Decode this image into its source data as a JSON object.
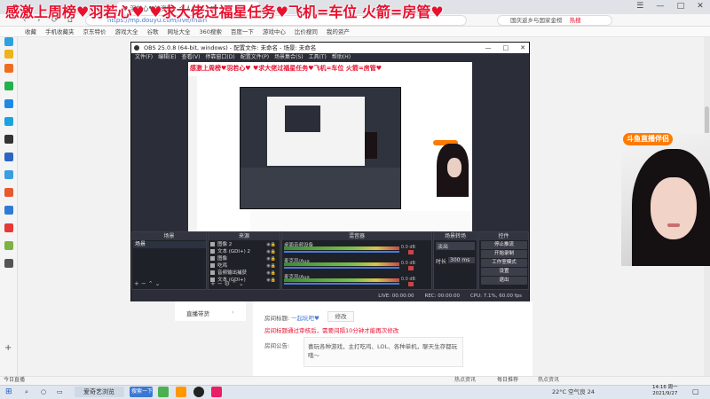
{
  "banner": {
    "text": "感激上周榜♥羽若心♥    ♥求大佬过福星任务♥飞机=车位 火箭=房管♥"
  },
  "browser": {
    "tab_title": "♥ 羽若心♥的资料 - 个人中心 - ♥",
    "url": "https://mp.douyu.com/live/main",
    "search_text": "国庆返乡与国家金榜",
    "search_hot": "热搜",
    "bookmarks": [
      "收藏",
      "手机收藏夹",
      "京东特价",
      "游戏大全",
      "谷歌",
      "网址大全",
      "360搜索",
      "百度一下",
      "游戏中心",
      "比价搜同",
      "我的资产"
    ]
  },
  "obs": {
    "title": "OBS 25.0.8 (64-bit, windows) - 配置文件: 未命名 - 场景: 未命名",
    "menu": [
      "文件(F)",
      "编辑(E)",
      "查看(V)",
      "停靠窗口(D)",
      "配置文件(P)",
      "场景集合(S)",
      "工具(T)",
      "帮助(H)"
    ],
    "preview_banner": "感激上周榜♥羽若心♥    ♥求大佬过福星任务♥飞机=车位 火箭=房管♥",
    "docks": {
      "scenes_title": "场景",
      "scene_name": "场景",
      "sources_title": "来源",
      "sources": [
        "图像 2",
        "文本 (GDI+) 2",
        "图像",
        "吃鸡",
        "音频输出捕获",
        "文本 (GDI+)"
      ],
      "mixer_title": "混音器",
      "mixer": [
        {
          "name": "桌面音频设备",
          "vol": "0.0 dB"
        },
        {
          "name": "麦克风/Aux",
          "vol": "0.0 dB"
        },
        {
          "name": "麦克风/Aux",
          "vol": "0.0 dB"
        }
      ],
      "transitions_title": "场景转场",
      "transition_type": "淡出",
      "duration_label": "时长",
      "duration_value": "300 ms",
      "controls_title": "控件",
      "controls": [
        "停止推流",
        "开始录制",
        "工作室模式",
        "设置",
        "退出"
      ]
    },
    "status": {
      "live": "LIVE: 00:00:00",
      "rec": "REC: 00:00:00",
      "cpu": "CPU: 7.1%, 60.00 fps"
    }
  },
  "page": {
    "room_title_label": "房间标题:",
    "room_title_value": "一起玩吧♥",
    "edit_label": "修改",
    "room_warning": "房间标题通过审核后，需要间隔10分钟才能再次修改",
    "notice_label": "房间公告:",
    "notice_text": "喜玩各种游戏，主打吃鸡、LOL、各种单机，聊天生存都玩哦～",
    "nav_item": "直播带货",
    "webcam_badge": "斗鱼直播伴侣"
  },
  "statusbar": {
    "left": "今日直播",
    "items": [
      "热点资讯",
      "每日推荐",
      "热点资讯"
    ]
  },
  "taskbar": {
    "app1": "爱奇艺浏览",
    "app2": "搜索一下",
    "weather": "22°C 空气良 24",
    "time": "14:16 周一",
    "date": "2021/9/27"
  }
}
